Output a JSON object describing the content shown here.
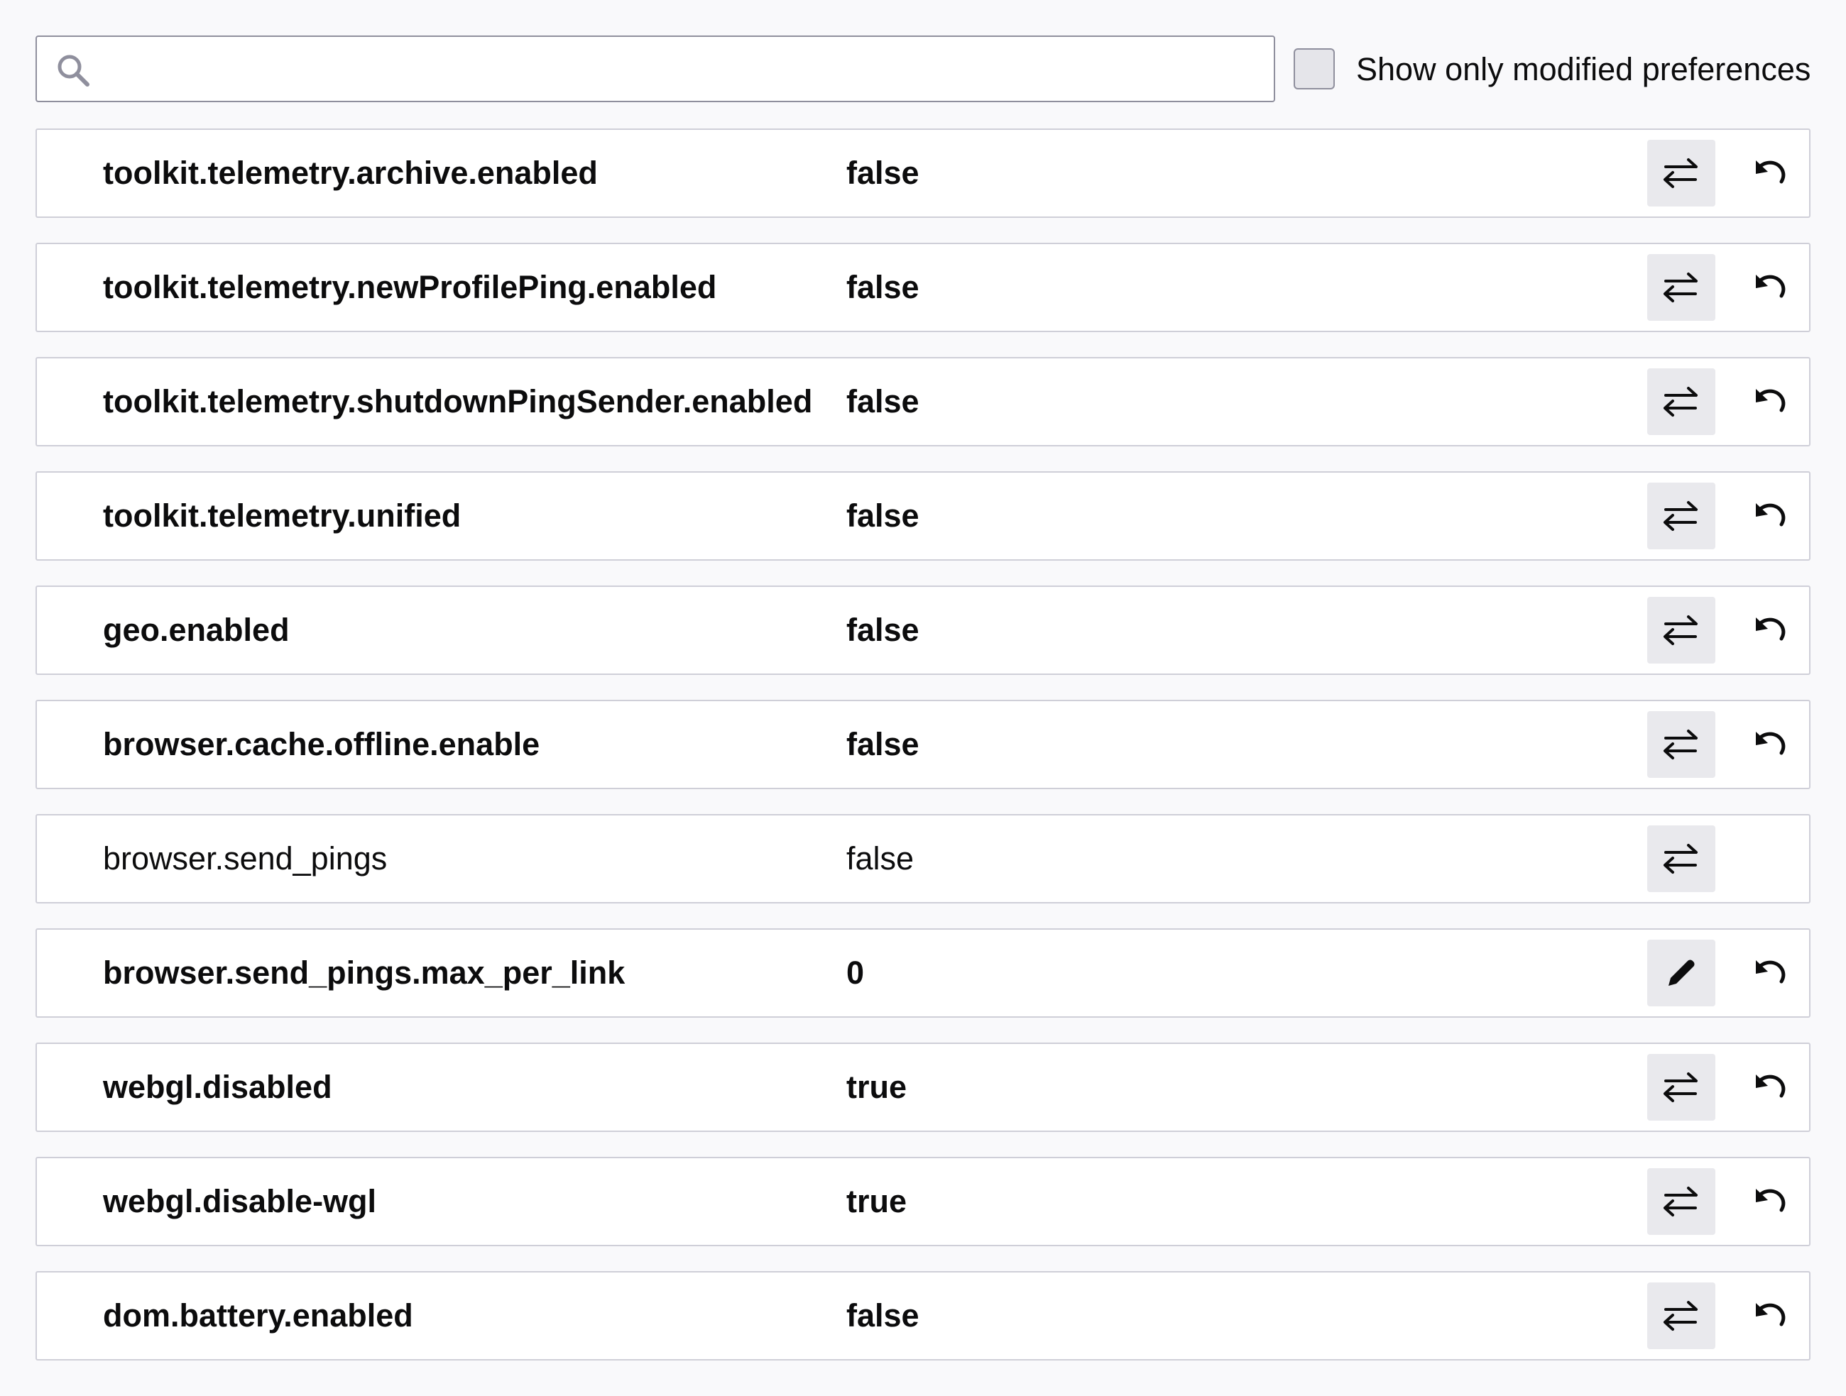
{
  "search": {
    "value": "",
    "placeholder": ""
  },
  "filter": {
    "checked": false,
    "label": "Show only modified preferences"
  },
  "preferences": [
    {
      "name": "toolkit.telemetry.archive.enabled",
      "value": "false",
      "modified": true,
      "action": "toggle"
    },
    {
      "name": "toolkit.telemetry.newProfilePing.enabled",
      "value": "false",
      "modified": true,
      "action": "toggle"
    },
    {
      "name": "toolkit.telemetry.shutdownPingSender.enabled",
      "value": "false",
      "modified": true,
      "action": "toggle"
    },
    {
      "name": "toolkit.telemetry.unified",
      "value": "false",
      "modified": true,
      "action": "toggle"
    },
    {
      "name": "geo.enabled",
      "value": "false",
      "modified": true,
      "action": "toggle"
    },
    {
      "name": "browser.cache.offline.enable",
      "value": "false",
      "modified": true,
      "action": "toggle"
    },
    {
      "name": "browser.send_pings",
      "value": "false",
      "modified": false,
      "action": "toggle"
    },
    {
      "name": "browser.send_pings.max_per_link",
      "value": "0",
      "modified": true,
      "action": "edit"
    },
    {
      "name": "webgl.disabled",
      "value": "true",
      "modified": true,
      "action": "toggle"
    },
    {
      "name": "webgl.disable-wgl",
      "value": "true",
      "modified": true,
      "action": "toggle"
    },
    {
      "name": "dom.battery.enabled",
      "value": "false",
      "modified": true,
      "action": "toggle"
    }
  ],
  "icons": {
    "search": "search-icon",
    "toggle": "toggle-icon",
    "edit": "edit-icon",
    "reset": "reset-icon"
  },
  "colors": {
    "background": "#f9f9fb",
    "row_border": "#cfcfd8",
    "button_bg": "#e9e9ed",
    "icon": "#0c0c0d",
    "search_icon": "#8f8f9d"
  }
}
